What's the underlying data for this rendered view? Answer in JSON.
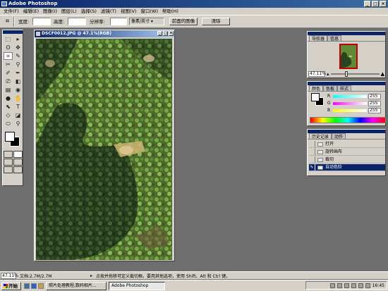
{
  "app": {
    "title": "Adobe Photoshop",
    "win_buttons": [
      "_",
      "□",
      "×"
    ]
  },
  "menubar": [
    "文件(F)",
    "编辑(E)",
    "图像(I)",
    "图层(L)",
    "选择(S)",
    "滤镜(T)",
    "视图(V)",
    "窗口(W)",
    "帮助(H)"
  ],
  "options": {
    "crop_icon": "crop-icon",
    "width_label": "宽度:",
    "width_value": "",
    "height_label": "高度:",
    "height_value": "",
    "resolution_label": "分辨率:",
    "resolution_value": "",
    "units": "像素/英寸 ▾",
    "front_image_button": "前面的图像",
    "clear_button": "清除"
  },
  "toolbox": {
    "tools": [
      "⬚",
      "▸",
      "ʘ",
      "✥",
      "⌗",
      "✎",
      "✂",
      "⚲",
      "✐",
      "✒",
      "⎚",
      "◧",
      "▤",
      "◉",
      "●",
      "✋",
      "⬉",
      "T",
      "◇",
      "◪",
      "⬭",
      "⚲",
      "✋",
      "🔍"
    ]
  },
  "document": {
    "title": "DSCF0012.JPG @ 47.1%(RGB)",
    "buttons": [
      "_",
      "□",
      "×"
    ]
  },
  "navigator": {
    "tabs": [
      "导航器",
      "信息"
    ],
    "zoom": "47.11%"
  },
  "color_panel": {
    "tabs": [
      "颜色",
      "色板",
      "样式"
    ],
    "channels": [
      {
        "label": "R",
        "value": "255"
      },
      {
        "label": "G",
        "value": "255"
      },
      {
        "label": "B",
        "value": "255"
      }
    ]
  },
  "history": {
    "tabs": [
      "历史记录",
      "动作"
    ],
    "items": [
      {
        "label": "打开",
        "current": false
      },
      {
        "label": "旋转画布",
        "current": false
      },
      {
        "label": "裁切",
        "current": false
      },
      {
        "label": "自动色阶",
        "current": true
      }
    ]
  },
  "status": {
    "zoom": "47.11%",
    "doc": "文档:2.7M/2.7M",
    "arrow": "▸",
    "hint": "点按并拖移可定义裁切框。要用其他选项，使用 Shift、Alt 和 Ctrl 键。"
  },
  "taskbar": {
    "start": "开始",
    "tasks": [
      {
        "label": "照片处理教程,数码相片...",
        "active": false
      },
      {
        "label": "Adobe Photoshop",
        "active": true
      }
    ],
    "clock": "16:45"
  }
}
